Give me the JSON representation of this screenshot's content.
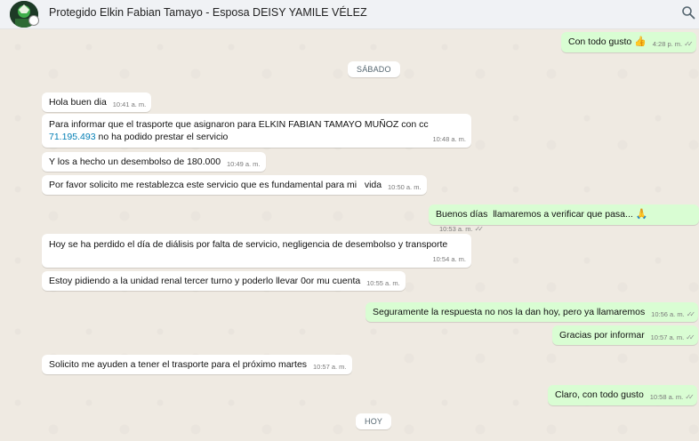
{
  "header": {
    "title": "Protegido Elkin Fabian Tamayo - Esposa DEISY YAMILE VÉLEZ",
    "avatar_icon": "contact-avatar",
    "search_icon": "search-icon"
  },
  "chips": {
    "saturday": "SÁBADO",
    "today": "HOY"
  },
  "messages": [
    {
      "text": "Con todo gusto",
      "emoji": "👍",
      "time": "4:28 p. m.",
      "ticks": "✓✓"
    },
    {
      "text": "Hola buen dia",
      "time": "10:41 a. m."
    },
    {
      "line1": "Para informar que el trasporte que asignaron para ELKIN FABIAN TAMAYO MUÑOZ con cc",
      "phone": "71.195.493",
      "line2": " no ha podido prestar el servicio",
      "time": "10:48 a. m."
    },
    {
      "text": "Y los a hecho un desembolso de 180.000",
      "time": "10:49 a. m."
    },
    {
      "text": "Por favor solicito me restablezca este servicio que es fundamental para mi   vida",
      "time": "10:50 a. m."
    },
    {
      "text": "Buenos días  llamaremos a verificar que pasa...",
      "emoji": "🙏",
      "time": "10:53 a. m.",
      "ticks": "✓✓"
    },
    {
      "text": "Hoy se ha perdido el día de diálisis por falta de servicio, negligencia de desembolso y transporte",
      "time": "10:54 a. m."
    },
    {
      "text": "Estoy pidiendo a la unidad renal tercer turno y poderlo llevar 0or mu cuenta",
      "time": "10:55 a. m."
    },
    {
      "text": "Seguramente la respuesta no nos la dan hoy, pero ya llamaremos",
      "time": "10:56 a. m.",
      "ticks": "✓✓"
    },
    {
      "text": "Gracias por informar",
      "time": "10:57 a. m.",
      "ticks": "✓✓"
    },
    {
      "text": "Solicito me ayuden a tener el trasporte para el próximo martes",
      "time": "10:57 a. m."
    },
    {
      "text": "Claro, con todo gusto",
      "time": "10:58 a. m.",
      "ticks": "✓✓"
    }
  ]
}
